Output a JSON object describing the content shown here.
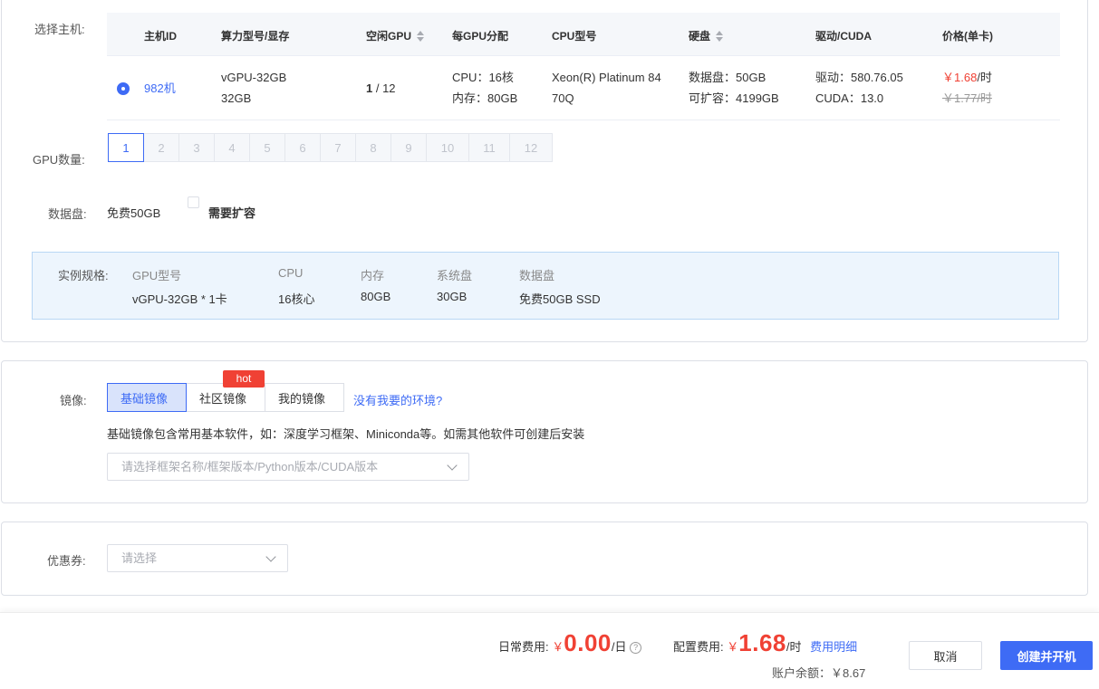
{
  "host": {
    "label": "选择主机:",
    "columns": {
      "host_id": "主机ID",
      "gpu_model": "算力型号/显存",
      "free_gpu": "空闲GPU",
      "per_gpu": "每GPU分配",
      "cpu_model": "CPU型号",
      "disk": "硬盘",
      "driver": "驱动/CUDA",
      "price": "价格(单卡)"
    },
    "row": {
      "host_id": "982机",
      "gpu_model": "vGPU-32GB",
      "vram": "32GB",
      "free_gpu_num": "1",
      "free_gpu_total": " / 12",
      "cpu": "CPU：16核",
      "mem": "内存：80GB",
      "cpu_model_line1": "Xeon(R) Platinum 84",
      "cpu_model_line2": "70Q",
      "data_disk": "数据盘：50GB",
      "expandable": "可扩容：4199GB",
      "driver": "驱动：580.76.05",
      "cuda": "CUDA：13.0",
      "price": "￥1.68",
      "price_unit": "/时",
      "old_price": "￥1.77/时"
    }
  },
  "gpu_count": {
    "label": "GPU数量:",
    "options": [
      "1",
      "2",
      "3",
      "4",
      "5",
      "6",
      "7",
      "8",
      "9",
      "10",
      "11",
      "12"
    ],
    "selected": "1"
  },
  "data_disk": {
    "label": "数据盘:",
    "free": "免费50GB",
    "expand_label": "需要扩容"
  },
  "spec": {
    "label": "实例规格:",
    "gpu_k": "GPU型号",
    "gpu_v": "vGPU-32GB * 1卡",
    "cpu_k": "CPU",
    "cpu_v": "16核心",
    "mem_k": "内存",
    "mem_v": "80GB",
    "sys_k": "系统盘",
    "sys_v": "30GB",
    "data_k": "数据盘",
    "data_v": "免费50GB SSD"
  },
  "image": {
    "label": "镜像:",
    "tabs": [
      "基础镜像",
      "社区镜像",
      "我的镜像"
    ],
    "hot_badge": "hot",
    "missing_link": "没有我要的环境?",
    "desc": "基础镜像包含常用基本软件，如：深度学习框架、Miniconda等。如需其他软件可创建后安装",
    "select_placeholder": "请选择框架名称/框架版本/Python版本/CUDA版本"
  },
  "coupon": {
    "label": "优惠券:",
    "placeholder": "请选择"
  },
  "footer": {
    "daily_label": "日常费用:",
    "daily_currency": "￥",
    "daily_amount": "0.00",
    "daily_unit": "/日",
    "config_label": "配置费用:",
    "config_currency": "￥",
    "config_amount": "1.68",
    "config_unit": "/时",
    "detail_link": "费用明细",
    "balance": "账户余额：￥8.67",
    "cancel": "取消",
    "create": "创建并开机"
  },
  "colors": {
    "accent": "#3e6bf5",
    "price_red": "#f04134"
  }
}
